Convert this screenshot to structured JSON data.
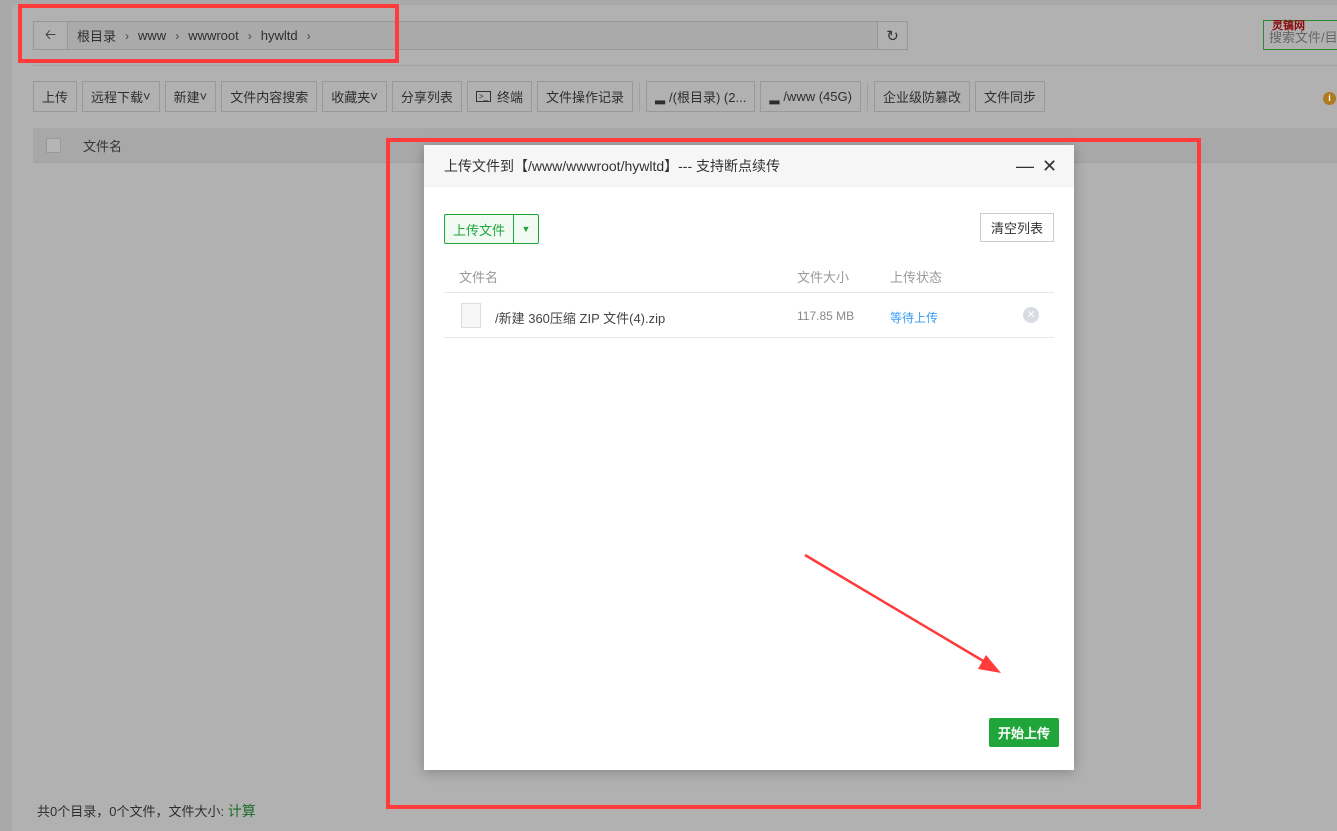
{
  "breadcrumb": {
    "items": [
      "根目录",
      "www",
      "wwwroot",
      "hywltd"
    ]
  },
  "search": {
    "placeholder": "搜索文件/目录"
  },
  "watermark": "灵镐网",
  "toolbar": {
    "buttons": [
      "上传",
      "远程下载",
      "新建",
      "文件内容搜索",
      "收藏夹",
      "分享列表",
      "终端",
      "文件操作记录"
    ],
    "disks": [
      "/(根目录) (2...",
      "/www (45G)"
    ],
    "extra": [
      "企业级防篡改",
      "文件同步"
    ]
  },
  "table": {
    "col_name": "文件名"
  },
  "footer": {
    "summary": "共0个目录，0个文件，文件大小:",
    "calc": "计算"
  },
  "modal": {
    "title": "上传文件到【/www/wwwroot/hywltd】--- 支持断点续传",
    "upload_button": "上传文件",
    "clear_button": "清空列表",
    "columns": [
      "文件名",
      "文件大小",
      "上传状态"
    ],
    "files": [
      {
        "name": "/新建 360压缩 ZIP 文件(4).zip",
        "size": "117.85 MB",
        "status": "等待上传"
      }
    ],
    "start_button": "开始上传"
  },
  "colors": {
    "accent": "#20a53a",
    "status_link": "#3b9cf5",
    "annotation": "#ff3b3b"
  }
}
